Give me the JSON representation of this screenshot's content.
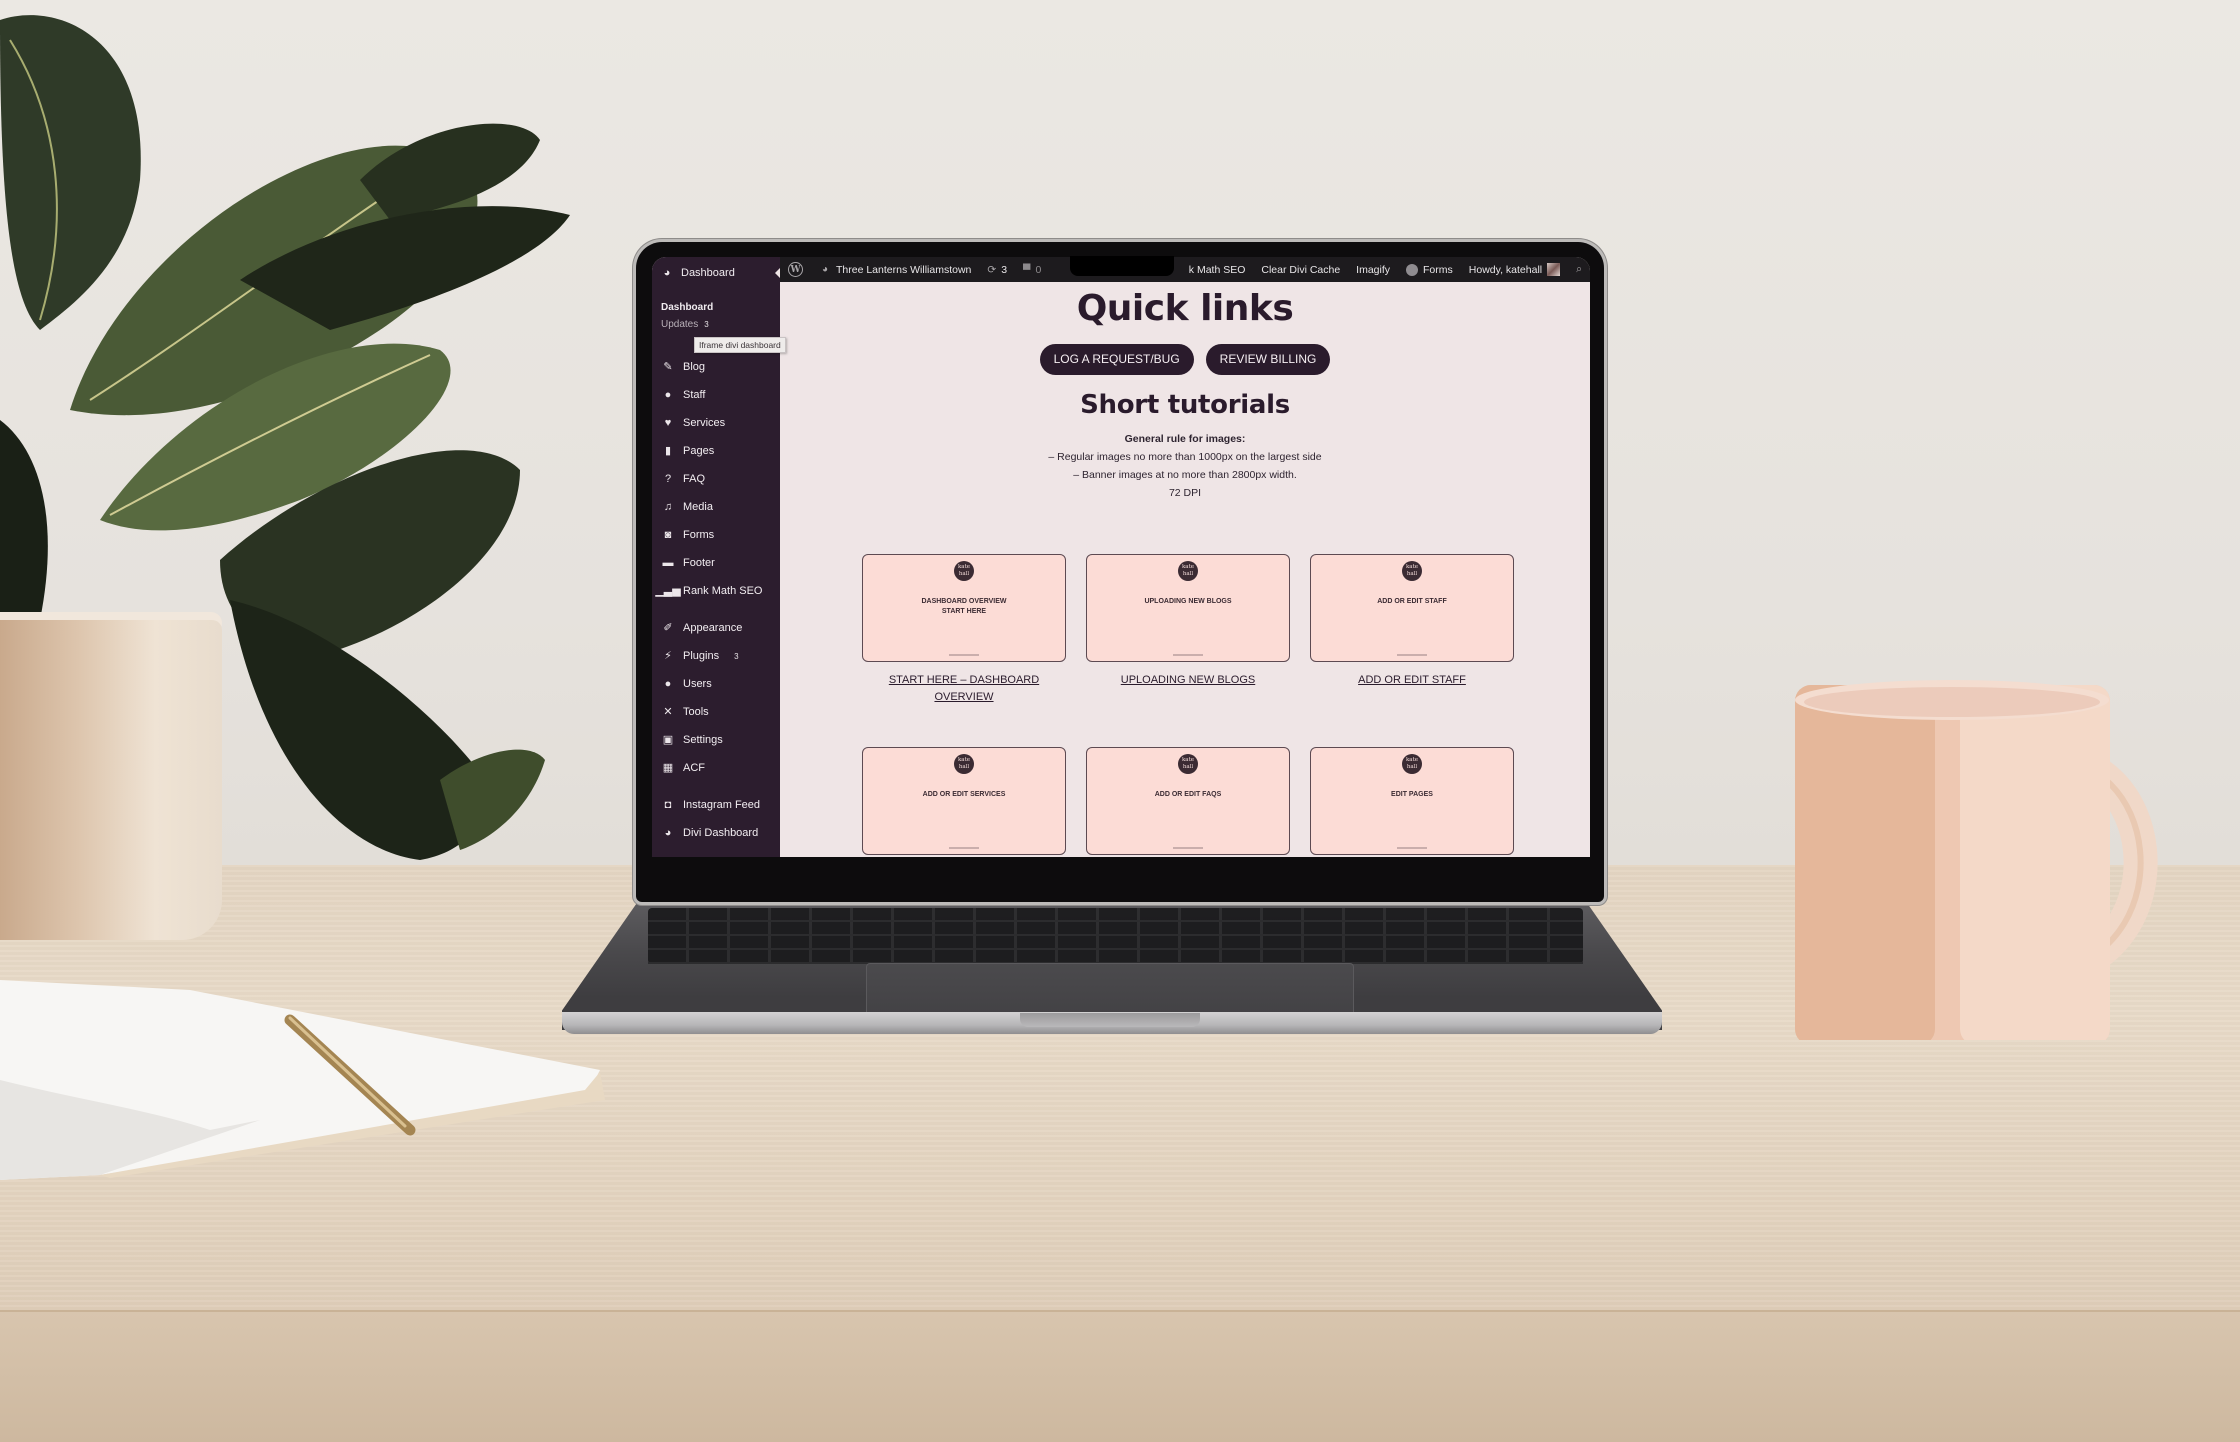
{
  "scene": {
    "objects": [
      "fiddle-leaf plant",
      "candle",
      "open notebook with pen",
      "laptop",
      "speckled mug",
      "wooden desk"
    ]
  },
  "adminbar": {
    "site_name": "Three Lanterns Williamstown",
    "updates_count": "3",
    "comments_count": "0",
    "rank_math": "k Math SEO",
    "clear_cache": "Clear Divi Cache",
    "imagify": "Imagify",
    "forms": "Forms",
    "howdy": "Howdy, katehall"
  },
  "sidebar": {
    "top_item": "Dashboard",
    "submenu": {
      "current": "Dashboard",
      "updates_label": "Updates",
      "updates_badge": "3"
    },
    "tooltip": "Iframe divi dashboard",
    "items": [
      {
        "label": "Blog",
        "icon": "edit-icon"
      },
      {
        "label": "Staff",
        "icon": "user-icon"
      },
      {
        "label": "Services",
        "icon": "heart-icon"
      },
      {
        "label": "Pages",
        "icon": "pages-icon"
      },
      {
        "label": "FAQ",
        "icon": "question-icon"
      },
      {
        "label": "Media",
        "icon": "media-icon"
      },
      {
        "label": "Forms",
        "icon": "forms-icon"
      },
      {
        "label": "Footer",
        "icon": "archive-icon"
      },
      {
        "label": "Rank Math SEO",
        "icon": "chart-icon"
      },
      {
        "label": "Appearance",
        "icon": "brush-icon"
      },
      {
        "label": "Plugins",
        "icon": "plugin-icon",
        "badge": "3"
      },
      {
        "label": "Users",
        "icon": "user-icon"
      },
      {
        "label": "Tools",
        "icon": "wrench-icon"
      },
      {
        "label": "Settings",
        "icon": "settings-icon"
      },
      {
        "label": "ACF",
        "icon": "grid-icon"
      },
      {
        "label": "Instagram Feed",
        "icon": "camera-icon"
      },
      {
        "label": "Divi Dashboard",
        "icon": "dashboard-icon"
      }
    ]
  },
  "main": {
    "quick_links_title": "Quick links",
    "buttons": [
      "LOG A REQUEST/BUG",
      "REVIEW BILLING"
    ],
    "tutorials_title": "Short tutorials",
    "rules": {
      "heading": "General rule for images:",
      "lines": [
        "– Regular images no more than 1000px on the largest side",
        "– Banner images at no more than 2800px width.",
        "72 DPI"
      ]
    },
    "logo_text": "kate hall",
    "tutorials": [
      {
        "thumb_line1": "DASHBOARD OVERVIEW",
        "thumb_line2": "START HERE",
        "link": "START HERE – DASHBOARD OVERVIEW"
      },
      {
        "thumb_line1": "UPLOADING NEW BLOGS",
        "thumb_line2": "",
        "link": "UPLOADING NEW BLOGS"
      },
      {
        "thumb_line1": "ADD OR EDIT STAFF",
        "thumb_line2": "",
        "link": "ADD OR EDIT STAFF"
      },
      {
        "thumb_line1": "ADD OR EDIT SERVICES",
        "thumb_line2": "",
        "link": ""
      },
      {
        "thumb_line1": "ADD OR EDIT FAQS",
        "thumb_line2": "",
        "link": ""
      },
      {
        "thumb_line1": "EDIT PAGES",
        "thumb_line2": "",
        "link": ""
      }
    ]
  },
  "colors": {
    "sidebar_bg": "#2c1d2e",
    "adminbar_bg": "#1d1b1e",
    "content_bg": "#efe5e6",
    "brand_dark": "#2a1b2c",
    "thumb_bg": "#fcdcd6"
  }
}
